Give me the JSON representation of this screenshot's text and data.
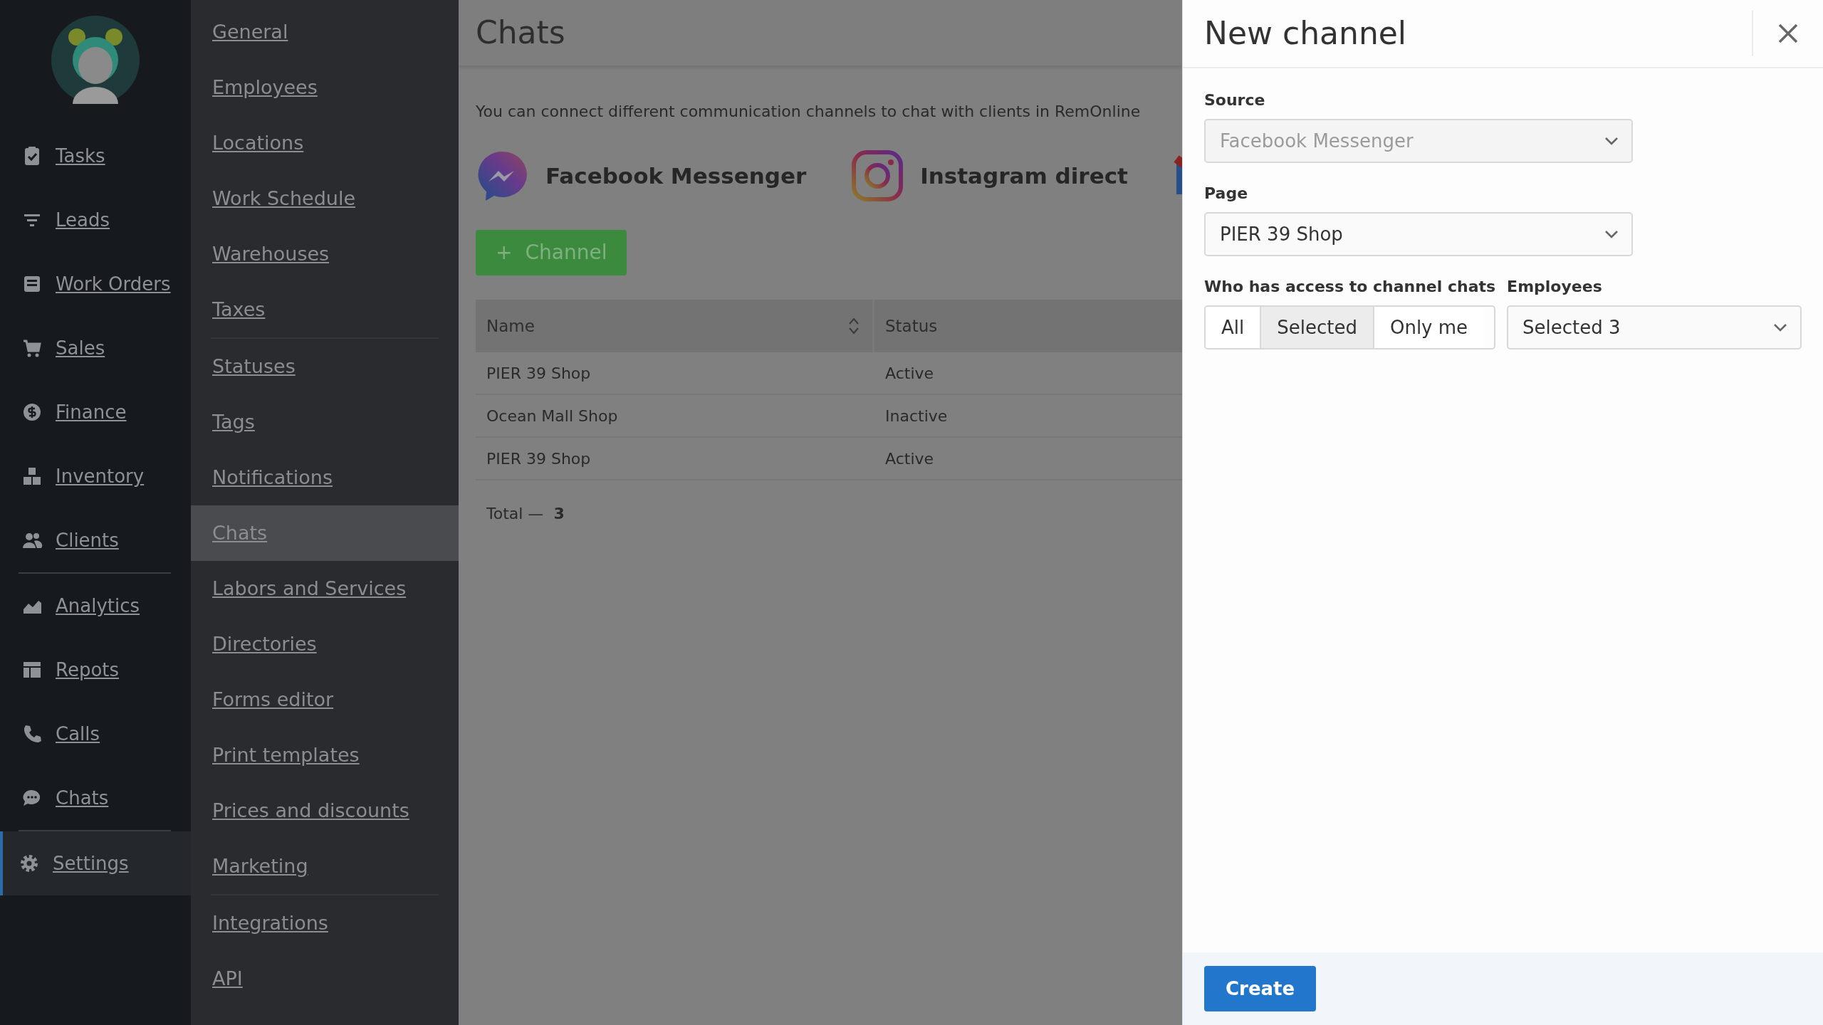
{
  "sidebar": {
    "groups": [
      [
        {
          "label": "Tasks",
          "selected": false
        },
        {
          "label": "Leads",
          "selected": false
        },
        {
          "label": "Work Orders",
          "selected": false
        },
        {
          "label": "Sales",
          "selected": false
        },
        {
          "label": "Finance",
          "selected": false
        },
        {
          "label": "Inventory",
          "selected": false
        },
        {
          "label": "Clients",
          "selected": false
        }
      ],
      [
        {
          "label": "Analytics",
          "selected": false
        },
        {
          "label": "Repots",
          "selected": false
        },
        {
          "label": "Calls",
          "selected": false
        },
        {
          "label": "Chats",
          "selected": false
        }
      ],
      [
        {
          "label": "Settings",
          "selected": true
        }
      ]
    ]
  },
  "settings_menu": {
    "groups": [
      [
        {
          "label": "General",
          "selected": false
        },
        {
          "label": "Employees",
          "selected": false
        },
        {
          "label": "Locations",
          "selected": false
        },
        {
          "label": "Work Schedule",
          "selected": false
        },
        {
          "label": "Warehouses",
          "selected": false
        },
        {
          "label": "Taxes",
          "selected": false
        }
      ],
      [
        {
          "label": "Statuses",
          "selected": false
        },
        {
          "label": "Tags",
          "selected": false
        },
        {
          "label": "Notifications",
          "selected": false
        },
        {
          "label": "Chats",
          "selected": true
        },
        {
          "label": "Labors and Services",
          "selected": false
        },
        {
          "label": "Directories",
          "selected": false
        },
        {
          "label": "Forms editor",
          "selected": false
        },
        {
          "label": "Print templates",
          "selected": false
        },
        {
          "label": "Prices and discounts",
          "selected": false
        },
        {
          "label": "Marketing",
          "selected": false
        }
      ],
      [
        {
          "label": "Integrations",
          "selected": false
        },
        {
          "label": "API",
          "selected": false
        }
      ]
    ]
  },
  "main": {
    "title": "Chats",
    "description": "You can connect different communication channels to chat with clients in RemOnline",
    "sources": [
      {
        "kind": "messenger",
        "label": "Facebook Messenger"
      },
      {
        "kind": "instagram",
        "label": "Instagram direct"
      },
      {
        "kind": "gmail"
      }
    ],
    "add_button": {
      "icon": "+",
      "label": "Channel"
    },
    "table": {
      "columns": [
        "Name",
        "Status"
      ],
      "rows": [
        [
          "PIER 39 Shop",
          "Active"
        ],
        [
          "Ocean Mall Shop",
          "Inactive"
        ],
        [
          "PIER 39 Shop",
          "Active"
        ]
      ]
    },
    "total": {
      "label": "Total —",
      "value": "3"
    }
  },
  "panel": {
    "title": "New channel",
    "source": {
      "label": "Source",
      "value": "Facebook Messenger",
      "disabled": true
    },
    "page": {
      "label": "Page",
      "value": "PIER 39 Shop",
      "disabled": false
    },
    "access": {
      "label": "Who has access to channel chats",
      "options": [
        {
          "label": "All",
          "selected": false
        },
        {
          "label": "Selected",
          "selected": true
        },
        {
          "label": "Only me",
          "selected": false
        }
      ]
    },
    "employees": {
      "label": "Employees",
      "value": "Selected 3",
      "disabled": false
    },
    "create_button": "Create"
  }
}
